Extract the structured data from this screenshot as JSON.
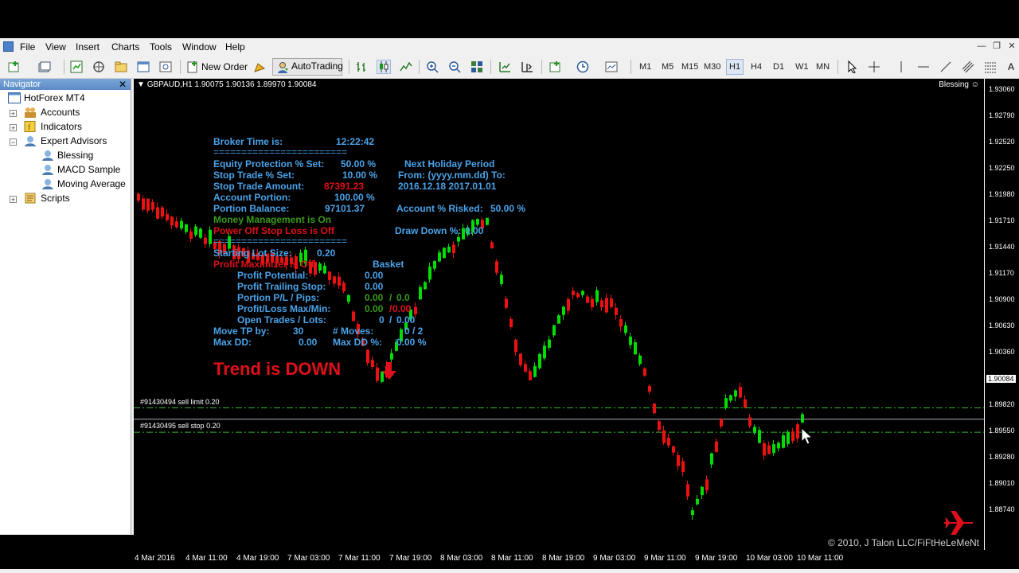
{
  "menu": [
    "File",
    "View",
    "Insert",
    "Charts",
    "Tools",
    "Window",
    "Help"
  ],
  "toolbar": {
    "new_order": "New Order",
    "autotrading": "AutoTrading",
    "timeframes": [
      "M1",
      "M5",
      "M15",
      "M30",
      "H1",
      "H4",
      "D1",
      "W1",
      "MN"
    ],
    "selected_tf": "H1"
  },
  "navigator": {
    "title": "Navigator",
    "items": [
      {
        "label": "HotForex MT4",
        "icon": "terminal-icon"
      },
      {
        "label": "Accounts",
        "icon": "accounts-icon"
      },
      {
        "label": "Indicators",
        "icon": "indicators-icon"
      },
      {
        "label": "Expert Advisors",
        "icon": "expert-advisors-icon"
      },
      {
        "label": "Blessing",
        "icon": "expert-icon"
      },
      {
        "label": "MACD Sample",
        "icon": "expert-icon"
      },
      {
        "label": "Moving Average",
        "icon": "expert-icon"
      },
      {
        "label": "Scripts",
        "icon": "scripts-icon"
      }
    ]
  },
  "chart": {
    "header": "GBPAUD,H1  1.90075 1.90136 1.89970 1.90084",
    "ea_name": "Blessing",
    "current_price": "1.90084",
    "y_ticks": [
      "1.93060",
      "1.92790",
      "1.92520",
      "1.92250",
      "1.91980",
      "1.91710",
      "1.91440",
      "1.91170",
      "1.90900",
      "1.90630",
      "1.90360",
      "1.90084",
      "1.89820",
      "1.89550",
      "1.89280",
      "1.89010",
      "1.88740"
    ],
    "x_ticks": [
      "4 Mar 2016",
      "4 Mar 11:00",
      "4 Mar 19:00",
      "7 Mar 03:00",
      "7 Mar 11:00",
      "7 Mar 19:00",
      "8 Mar 03:00",
      "8 Mar 11:00",
      "8 Mar 19:00",
      "9 Mar 03:00",
      "9 Mar 11:00",
      "9 Mar 19:00",
      "10 Mar 03:00",
      "10 Mar 11:00"
    ],
    "orders": [
      {
        "label": "#91430494 sell limit 0.20",
        "price": 1.902
      },
      {
        "label": "#91430495 sell stop 0.20",
        "price": 1.8995
      }
    ],
    "trend": "Trend is DOWN",
    "copyright": "© 2010, J Talon LLC/FiFtHeLeMeNt",
    "colors": {
      "up": "#00dd00",
      "down": "#ee1111",
      "background": "#000000",
      "info": "#4aa3ea",
      "alert": "#e0101a"
    }
  },
  "ea_panel": {
    "broker_time_label": "Broker Time is:",
    "broker_time": "12:22:42",
    "separator": "========================",
    "equity_label": "Equity Protection % Set:",
    "equity": "50.00 %",
    "stop_pct_label": "Stop Trade % Set:",
    "stop_pct": "10.00 %",
    "stop_amt_label": "Stop Trade Amount:",
    "stop_amt": "87391.23",
    "account_portion_label": "Account Portion:",
    "account_portion": "100.00 %",
    "portion_balance_label": "Portion Balance:",
    "portion_balance": "97101.37",
    "money_mgmt": "Money Management is On",
    "power_off": "Power Off Stop Loss is Off",
    "holiday_title": "Next Holiday Period",
    "holiday_from_to": "From: (yyyy.mm.dd) To:",
    "holiday_dates": "2016.12.18  2017.01.01",
    "risked_label": "Account % Risked:",
    "risked": "50.00 %",
    "drawdown_label": "Draw Down %:",
    "drawdown": "0.00",
    "lot_label": "Starting Lot Size:",
    "lot": "0.20",
    "profit_max": "Profit Maximizer is Off",
    "basket": "Basket",
    "profit_potential_label": "Profit Potential:",
    "profit_potential": "0.00",
    "trailing_label": "Profit Trailing Stop:",
    "trailing": "0.00",
    "pl_label": "Portion P/L / Pips:",
    "pl_val": "0.00",
    "pl_pips": "0.0",
    "maxmin_label": "Profit/Loss Max/Min:",
    "max_val": "0.00",
    "min_val": "0.00",
    "open_label": "Open Trades / Lots:",
    "open_trades": "0",
    "open_lots": "0.00",
    "move_tp_label": "Move TP by:",
    "move_tp": "30",
    "moves_label": "# Moves:",
    "moves": "0 / 2",
    "maxdd_label": "Max DD:",
    "maxdd": "0.00",
    "maxdd_pct_label": "Max DD %:",
    "maxdd_pct": "0.00 %",
    "slash": "/"
  }
}
